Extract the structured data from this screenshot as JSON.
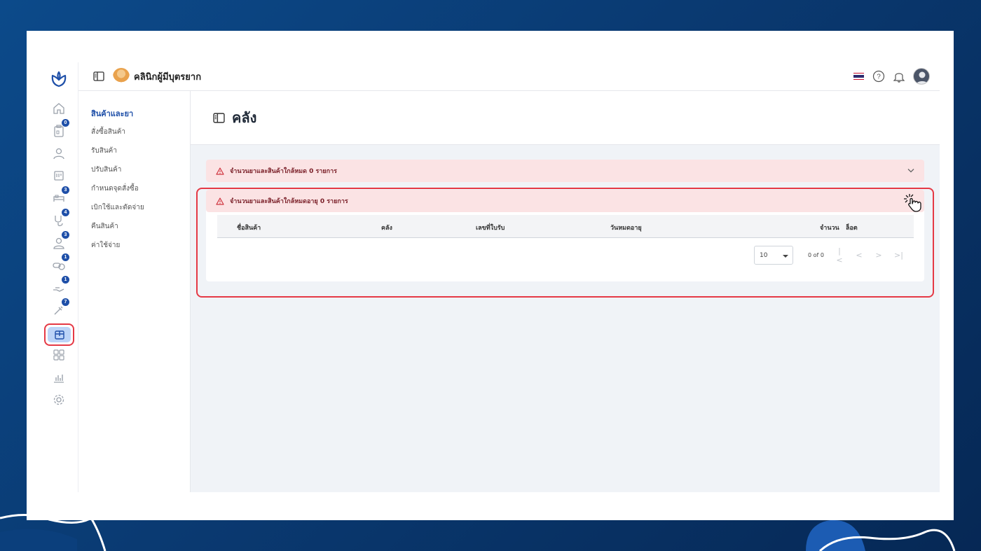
{
  "topbar": {
    "clinic_name": "คลินิกผู้มีบุตรยาก"
  },
  "rail": {
    "badges": {
      "orders": "0",
      "beds": "3",
      "lab": "4",
      "staff": "3",
      "pharmacy": "1",
      "hand": "1",
      "tools": "7"
    }
  },
  "submenu": {
    "heading": "สินค้าและยา",
    "items": [
      "สั่งซื้อสินค้า",
      "รับสินค้า",
      "ปรับสินค้า",
      "กำหนดจุดสั่งซื้อ",
      "เบิกใช้และตัดจ่าย",
      "คืนสินค้า",
      "ค่าใช้จ่าย"
    ]
  },
  "page": {
    "title": "คลัง"
  },
  "alerts": {
    "out_of_stock": "จำนวนยาและสินค้าใกล้หมด 0 รายการ",
    "expiring": "จำนวนยาและสินค้าใกล้หมดอายุ 0 รายการ"
  },
  "table": {
    "columns": [
      "ชื่อสินค้า",
      "คลัง",
      "เลขที่ใบรับ",
      "วันหมดอายุ",
      "จำนวน",
      "ล็อต"
    ]
  },
  "pagination": {
    "page_size": "10",
    "range": "0 of 0"
  },
  "colors": {
    "brand": "#1e4fa8",
    "alert_bg": "#fbe3e4",
    "highlight": "#e53945",
    "background": "#0a3a72"
  }
}
